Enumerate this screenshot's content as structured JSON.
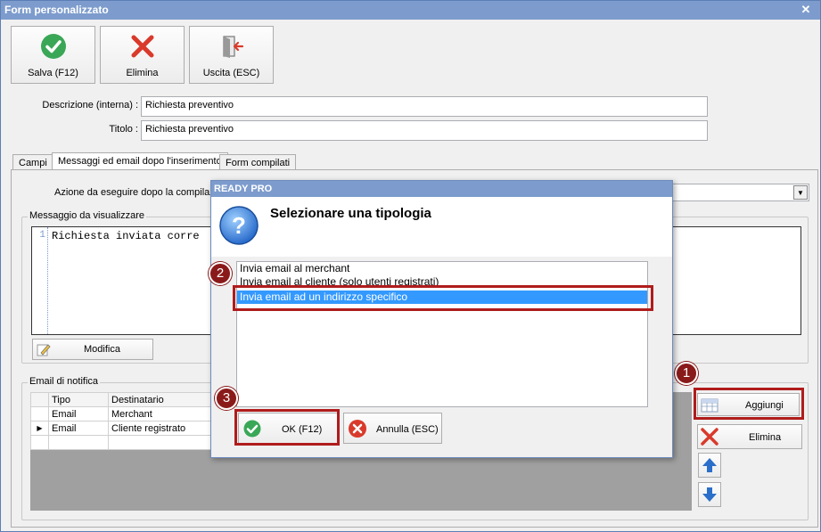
{
  "window": {
    "title": "Form personalizzato",
    "close_glyph": "✕"
  },
  "toolbar": {
    "save_label": "Salva (F12)",
    "delete_label": "Elimina",
    "exit_label": "Uscita (ESC)"
  },
  "form": {
    "description_label": "Descrizione (interna) :",
    "description_value": "Richiesta preventivo",
    "title_label": "Titolo :",
    "title_value": "Richiesta preventivo"
  },
  "tabs": [
    {
      "label": "Campi"
    },
    {
      "label": "Messaggi ed email dopo l'inserimento"
    },
    {
      "label": "Form compilati"
    }
  ],
  "action": {
    "label": "Azione da eseguire dopo la compilazione"
  },
  "message_group": {
    "label": "Messaggio da visualizzare",
    "line_number": "1",
    "code_text": "Richiesta inviata corre",
    "edit_button": "Modifica"
  },
  "email_group": {
    "label": "Email di notifica",
    "columns": [
      "Tipo",
      "Destinatario"
    ],
    "rows": [
      {
        "tipo": "Email",
        "destinatario": "Merchant"
      },
      {
        "tipo": "Email",
        "destinatario": "Cliente registrato"
      }
    ],
    "add_button": "Aggiungi",
    "delete_button": "Elimina"
  },
  "dialog": {
    "title": "READY PRO",
    "heading": "Selezionare una tipologia",
    "options": [
      "Invia email al merchant",
      "Invia email al cliente (solo utenti registrati)",
      "Invia email ad un indirizzo specifico"
    ],
    "selected_index": 2,
    "ok_label": "OK (F12)",
    "cancel_label": "Annulla (ESC)"
  },
  "annotations": {
    "step1": "1",
    "step2": "2",
    "step3": "3"
  },
  "colors": {
    "titlebar": "#7d9ccd",
    "selection": "#3399ff",
    "annotation_red": "#b01c1c",
    "green_icon": "#3aa757",
    "red_icon": "#d93a2b",
    "blue_arrow": "#2a6fc9"
  }
}
